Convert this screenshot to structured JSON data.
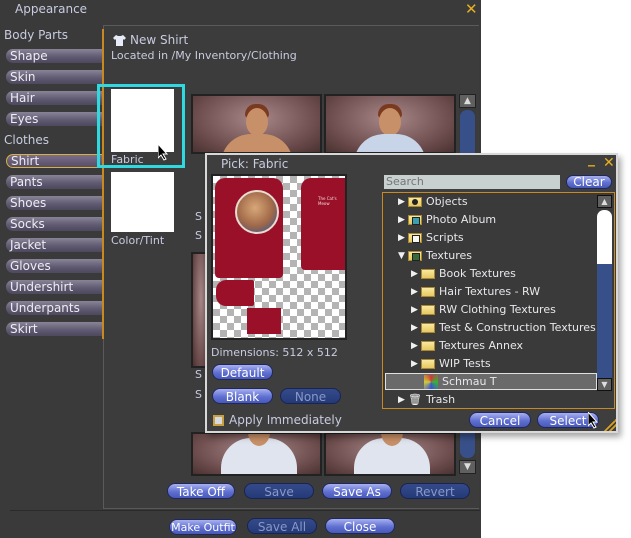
{
  "appearance": {
    "title": "Appearance",
    "close_icon": "close-icon",
    "sections": {
      "body_parts": "Body Parts",
      "clothes": "Clothes"
    },
    "body_parts": [
      "Shape",
      "Skin",
      "Hair",
      "Eyes"
    ],
    "clothes": [
      "Shirt",
      "Pants",
      "Shoes",
      "Socks",
      "Jacket",
      "Gloves",
      "Undershirt",
      "Underpants",
      "Skirt"
    ],
    "active_item": "Shirt",
    "item": {
      "icon": "shirt-icon",
      "name": "New Shirt",
      "location": "Located in /My Inventory/Clothing"
    },
    "swatches": {
      "fabric_label": "Fabric",
      "color_label": "Color/Tint"
    },
    "partial_labels": [
      "S",
      "S",
      "S",
      "S"
    ],
    "buttons": {
      "take_off": "Take Off",
      "save": "Save",
      "save_as": "Save As",
      "revert": "Revert",
      "make_outfit": "Make Outfit",
      "save_all": "Save All",
      "close": "Close"
    }
  },
  "picker": {
    "title": "Pick: Fabric",
    "dimensions": "Dimensions: 512 x 512",
    "back_text": "The Cat's Meow",
    "buttons": {
      "default": "Default",
      "blank": "Blank",
      "none": "None",
      "clear": "Clear",
      "cancel": "Cancel",
      "select": "Select"
    },
    "apply_immediately": "Apply Immediately",
    "apply_immediately_checked": false,
    "search_placeholder": "Search",
    "tree": [
      {
        "label": "Objects",
        "level": 0,
        "expanded": false,
        "icon": "objects-folder-icon"
      },
      {
        "label": "Photo Album",
        "level": 0,
        "expanded": false,
        "icon": "photo-album-folder-icon"
      },
      {
        "label": "Scripts",
        "level": 0,
        "expanded": false,
        "icon": "scripts-folder-icon"
      },
      {
        "label": "Textures",
        "level": 0,
        "expanded": true,
        "icon": "textures-folder-icon"
      },
      {
        "label": "Book Textures",
        "level": 1,
        "expanded": false,
        "icon": "folder-icon"
      },
      {
        "label": "Hair Textures - RW",
        "level": 1,
        "expanded": false,
        "icon": "folder-icon"
      },
      {
        "label": "RW Clothing Textures",
        "level": 1,
        "expanded": false,
        "icon": "folder-icon"
      },
      {
        "label": "Test & Construction Textures",
        "level": 1,
        "expanded": false,
        "icon": "folder-icon"
      },
      {
        "label": "Textures Annex",
        "level": 1,
        "expanded": false,
        "icon": "folder-icon"
      },
      {
        "label": "WIP Tests",
        "level": 1,
        "expanded": false,
        "icon": "folder-icon"
      },
      {
        "label": "Schmau T",
        "level": 1,
        "selected": true,
        "icon": "texture-icon"
      },
      {
        "label": "Trash",
        "level": 0,
        "expanded": false,
        "icon": "trash-icon"
      }
    ]
  },
  "colors": {
    "accent_orange": "#e8b020",
    "highlight_cyan": "#30d8e0",
    "button_blue": "#6070d0",
    "fabric_red": "#9a1028"
  }
}
